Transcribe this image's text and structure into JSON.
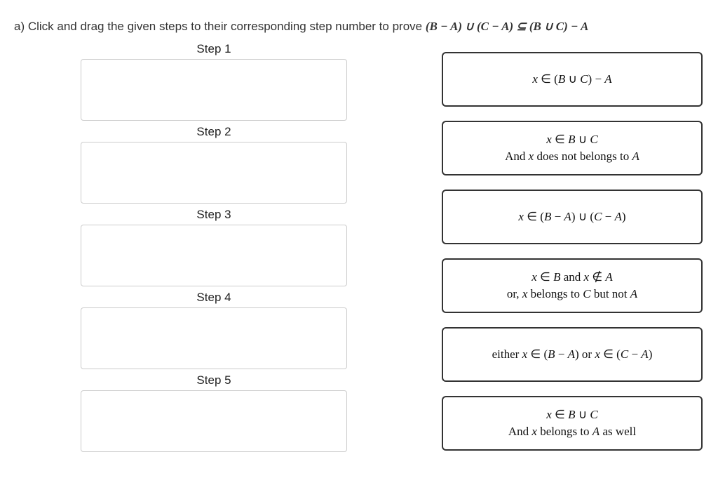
{
  "prompt": {
    "prefix": "a) Click and drag the given steps to their corresponding step number to prove ",
    "expression": "(B − A) ∪ (C − A) ⊆ (B ∪ C) − A"
  },
  "steps": [
    {
      "label": "Step 1"
    },
    {
      "label": "Step 2"
    },
    {
      "label": "Step 3"
    },
    {
      "label": "Step 4"
    },
    {
      "label": "Step 5"
    }
  ],
  "options": [
    {
      "line1": "x ∈ (B ∪ C) − A",
      "line2": ""
    },
    {
      "line1": "x ∈ B ∪ C",
      "line2": "And x does not belongs to A"
    },
    {
      "line1": "x ∈ (B − A) ∪ (C − A)",
      "line2": ""
    },
    {
      "line1": "x ∈ B and x ∉ A",
      "line2": "or, x belongs to C but not A"
    },
    {
      "line1": "either x ∈ (B − A) or x ∈ (C − A)",
      "line2": ""
    },
    {
      "line1": "x ∈ B ∪ C",
      "line2": "And x belongs to A as well"
    }
  ]
}
